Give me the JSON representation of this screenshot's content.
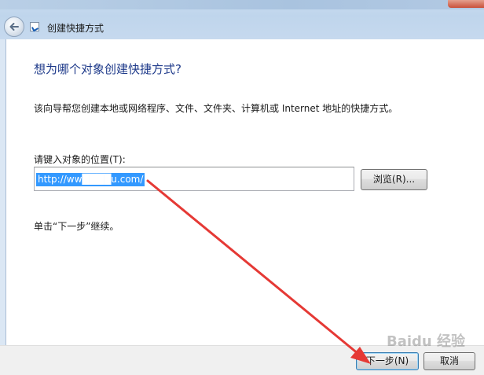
{
  "window": {
    "title": "创建快捷方式"
  },
  "page": {
    "heading": "想为哪个对象创建快捷方式?",
    "description": "该向导帮您创建本地或网络程序、文件、文件夹、计算机或 Internet 地址的快捷方式。",
    "field_label": "请键入对象的位置(T):",
    "location_value": "http://ww████u.com/",
    "browse_label": "浏览(R)...",
    "hint": "单击“下一步”继续。"
  },
  "footer": {
    "next_label": "下一步(N)",
    "cancel_label": "取消"
  },
  "watermark": {
    "text": "Baidu 经验"
  },
  "colors": {
    "heading": "#1e3a8a",
    "selection": "#3399ff",
    "arrow": "#e53935"
  }
}
